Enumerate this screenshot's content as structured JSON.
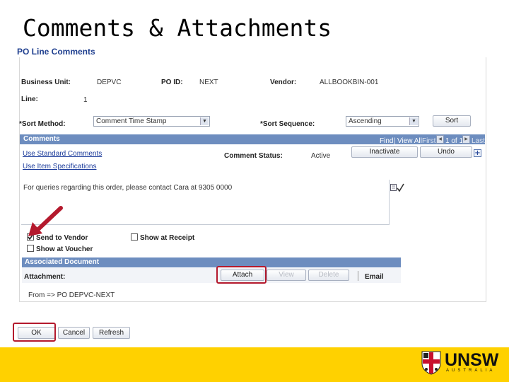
{
  "slide": {
    "title": "Comments & Attachments"
  },
  "page": {
    "heading": "PO Line Comments"
  },
  "header": {
    "business_unit_label": "Business Unit:",
    "business_unit_value": "DEPVC",
    "po_id_label": "PO ID:",
    "po_id_value": "NEXT",
    "vendor_label": "Vendor:",
    "vendor_value": "ALLBOOKBIN-001",
    "line_label": "Line:",
    "line_value": "1"
  },
  "sort": {
    "method_label": "*Sort Method:",
    "method_value": "Comment Time Stamp",
    "sequence_label": "*Sort Sequence:",
    "sequence_value": "Ascending",
    "sort_button": "Sort"
  },
  "comments_grid": {
    "title": "Comments",
    "nav_find": "Find",
    "nav_view_all": "View All",
    "nav_first": "First",
    "nav_position": "1 of 1",
    "nav_last": "Last",
    "use_standard_comments": "Use Standard Comments",
    "use_item_specifications": "Use Item Specifications",
    "comment_status_label": "Comment Status:",
    "comment_status_value": "Active",
    "inactivate_button": "Inactivate",
    "undo_button": "Undo",
    "comment_text": "For queries regarding this order, please contact Cara at 9305 0000",
    "send_to_vendor": "Send to Vendor",
    "show_at_receipt": "Show at Receipt",
    "show_at_voucher": "Show at Voucher",
    "send_to_vendor_checked": true
  },
  "attachments": {
    "title": "Associated Document",
    "attachment_label": "Attachment:",
    "attach_button": "Attach",
    "view_button": "View",
    "delete_button": "Delete",
    "email_label": "Email",
    "from_text": "From => PO DEPVC-NEXT"
  },
  "footer_buttons": {
    "ok": "OK",
    "cancel": "Cancel",
    "refresh": "Refresh"
  },
  "branding": {
    "logo_text": "UNSW",
    "logo_subtext": "AUSTRALIA"
  },
  "colors": {
    "header_bar": "#6d8dbf",
    "highlight": "#b4192d",
    "footer": "#ffd100",
    "link": "#1a3a9a"
  }
}
